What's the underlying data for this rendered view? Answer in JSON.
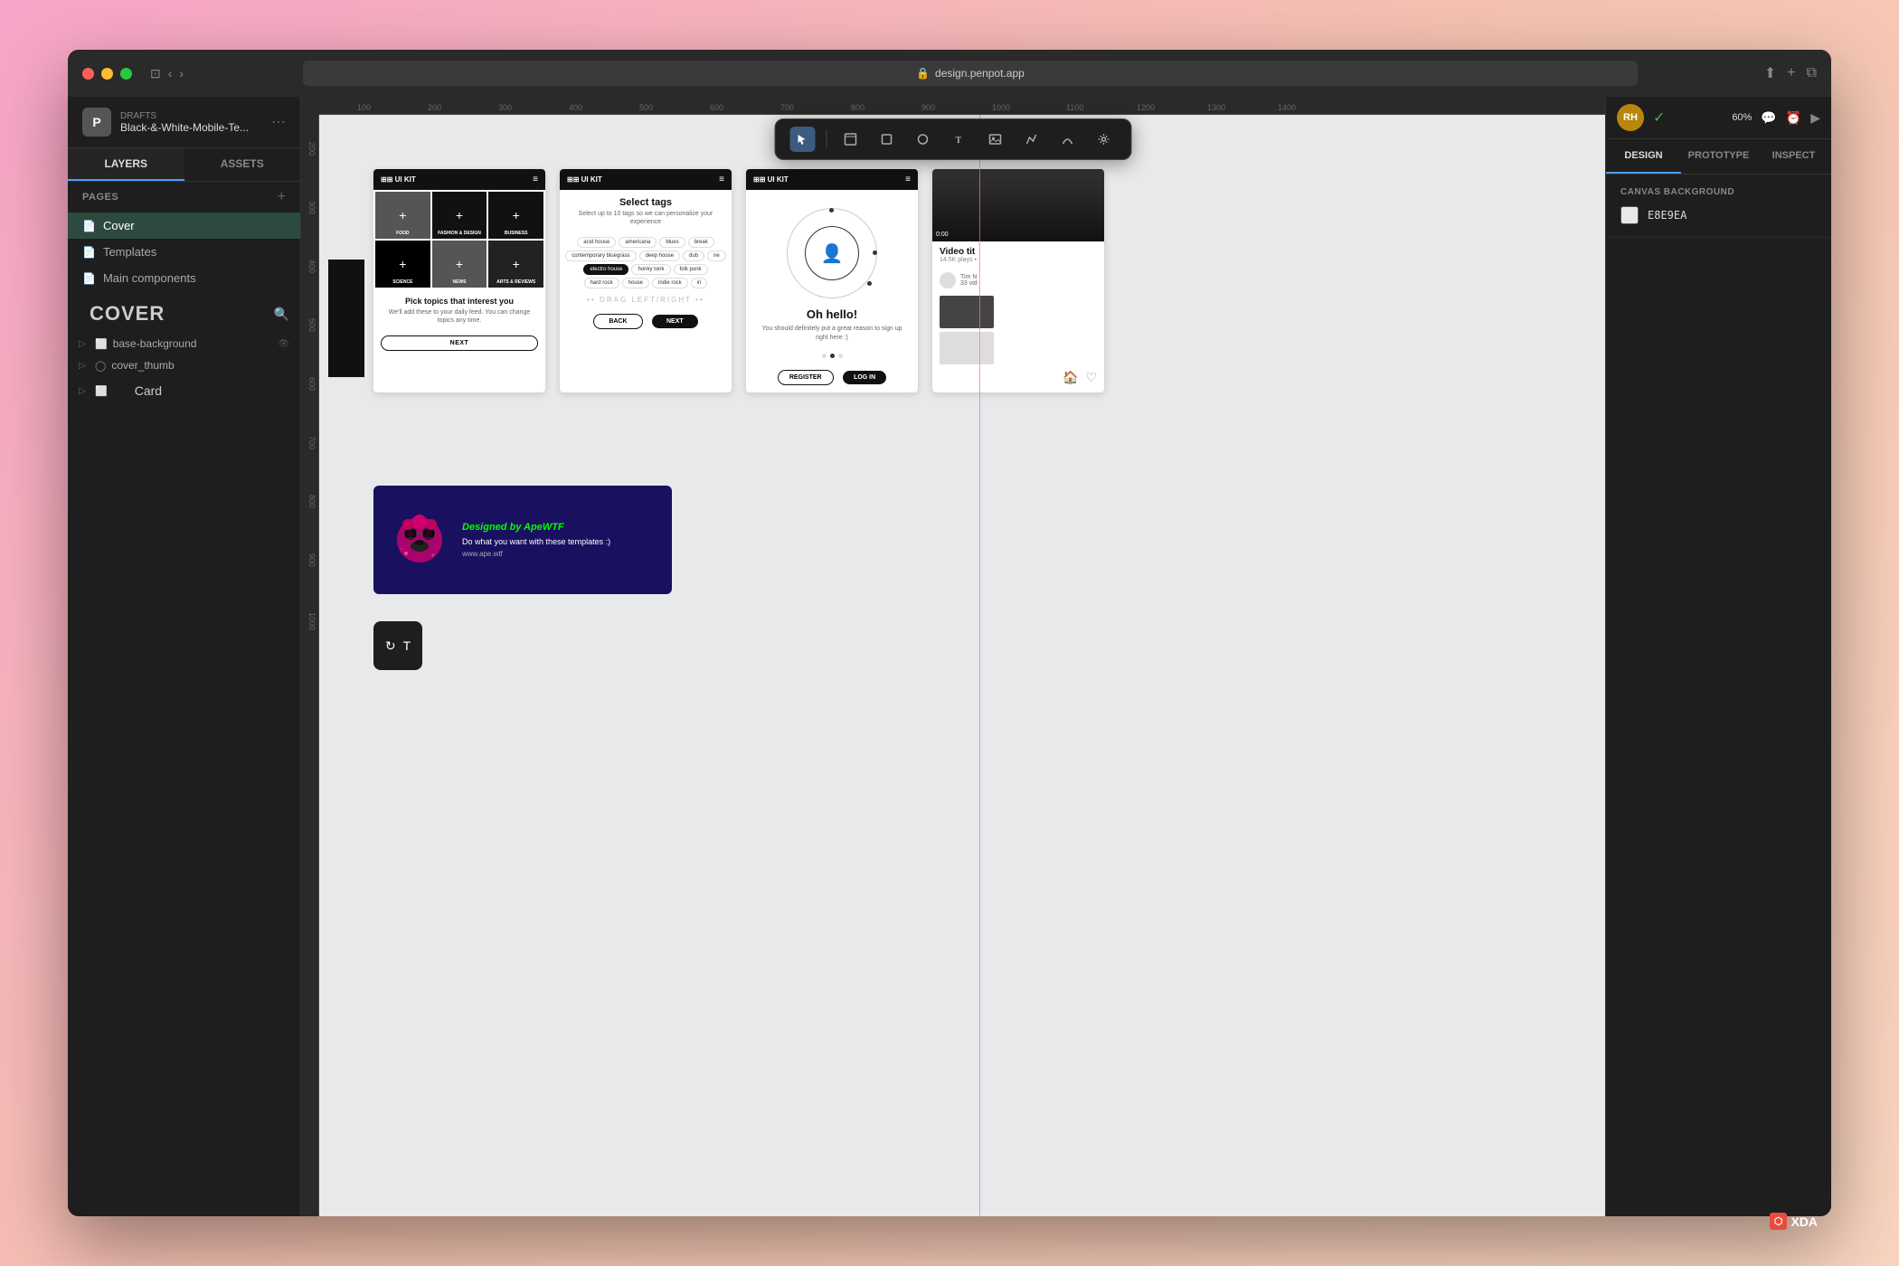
{
  "window": {
    "title": "Black-&-White-Mobile-Te...",
    "url": "design.penpot.app",
    "drafts_label": "DRAFTS"
  },
  "sidebar": {
    "tabs": [
      "LAYERS",
      "ASSETS"
    ],
    "active_tab": "LAYERS",
    "pages_label": "PAGES",
    "pages": [
      {
        "id": "cover",
        "label": "Cover",
        "active": true
      },
      {
        "id": "templates",
        "label": "Templates",
        "active": false
      },
      {
        "id": "main-components",
        "label": "Main components",
        "active": false
      }
    ],
    "cover_layer": "COVER",
    "layers": [
      {
        "id": "base-background",
        "label": "base-background",
        "expand": false
      },
      {
        "id": "cover-thumb",
        "label": "cover_thumb",
        "expand": false
      },
      {
        "id": "card",
        "label": "Card",
        "expand": false
      }
    ]
  },
  "toolbar": {
    "tools": [
      "select",
      "frame",
      "rectangle",
      "ellipse",
      "text",
      "image",
      "pen",
      "curve",
      "gear"
    ]
  },
  "canvas": {
    "bg_color": "#E8E9EA",
    "rulers": {
      "marks": [
        "100",
        "200",
        "300",
        "400",
        "500",
        "600",
        "700",
        "800",
        "900",
        "1000",
        "1100",
        "1200",
        "1300",
        "1400"
      ]
    }
  },
  "frames": {
    "frame1": {
      "header": "⊞⊞ UI KIT",
      "title": "Pick topics that interest you",
      "subtitle": "We'll add these to your daily feed. You can change topics any time.",
      "btn": "NEXT",
      "topics": [
        {
          "label": "FOOD",
          "type": "dark"
        },
        {
          "label": "FASHION & DESIGN",
          "type": "img"
        },
        {
          "label": "BUSINESS",
          "type": "dark"
        },
        {
          "label": "SCIENCE",
          "type": "black"
        },
        {
          "label": "NEWS",
          "type": "img"
        },
        {
          "label": "ARTS & REVIEWS",
          "type": "dark"
        }
      ]
    },
    "frame2": {
      "header": "⊞⊞ UI KIT",
      "title": "Select tags",
      "subtitle": "Select up to 10 tags so we can personalize your experience",
      "tags": [
        "acid house",
        "americana",
        "blues",
        "break",
        "contemporary bluegrass",
        "deep house",
        "dub",
        "ne",
        "electro house",
        "honky tonk",
        "folk punk",
        "hard rock",
        "house",
        "indie rock",
        "in"
      ],
      "active_tags": [
        "electro house"
      ],
      "drag_text": "•• DRAG LEFT/RIGHT ••",
      "btn_back": "BACK",
      "btn_next": "NEXT"
    },
    "frame3": {
      "header": "⊞⊞ UI KIT",
      "title": "Oh hello!",
      "subtitle": "You should definitely put a great reason to sign up right here :)",
      "btn_register": "REGISTER",
      "btn_login": "LOG IN",
      "dots": [
        false,
        true,
        false
      ]
    },
    "frame4": {
      "time": "0:00",
      "video_title": "Video tit",
      "video_meta": "14.5K plays •"
    }
  },
  "banner": {
    "title": "Designed by ApeWTF",
    "subtitle": "Do what you want with these templates :)",
    "url": "www.ape.wtf"
  },
  "right_sidebar": {
    "tabs": [
      "DESIGN",
      "PROTOTYPE",
      "INSPECT"
    ],
    "active_tab": "DESIGN",
    "canvas_background_label": "CANVAS BACKGROUND",
    "bg_color": "E8E9EA"
  },
  "top_right": {
    "user_initials": "RH",
    "zoom": "60%"
  },
  "xda": {
    "label": "XDA"
  }
}
